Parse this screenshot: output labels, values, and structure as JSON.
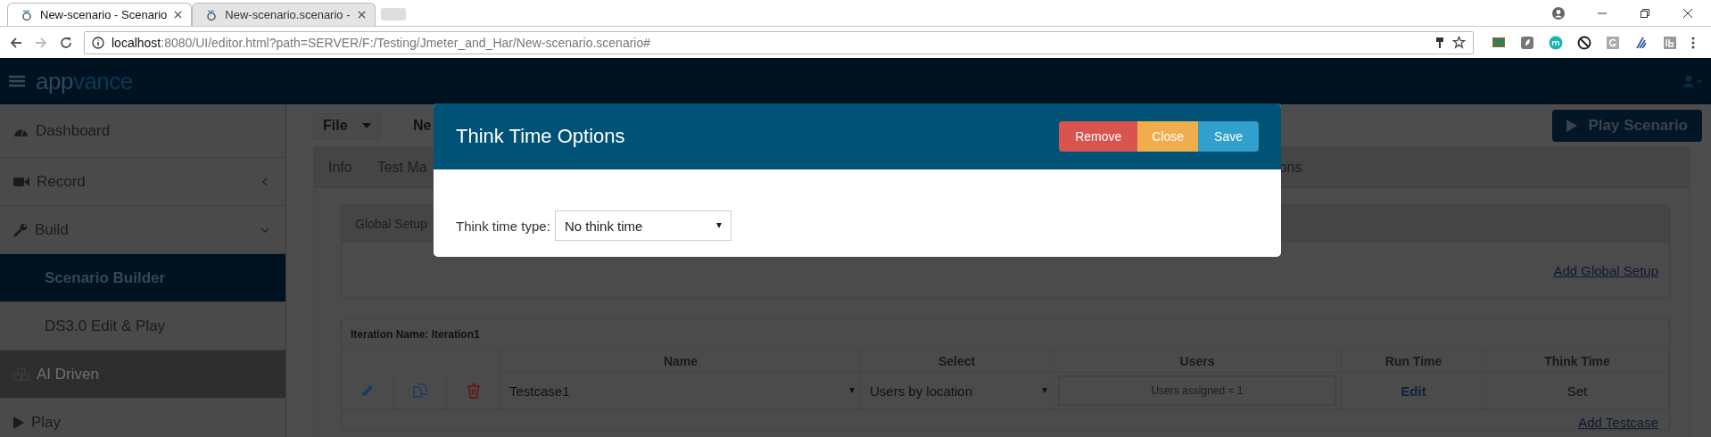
{
  "browser": {
    "tabs": [
      {
        "title": "New-scenario - Scenario",
        "selected": true
      },
      {
        "title": "New-scenario.scenario -",
        "selected": false
      }
    ],
    "address": {
      "host": "localhost",
      "path": ":8080/UI/editor.html?path=SERVER/F:/Testing/Jmeter_and_Har/New-scenario.scenario#"
    }
  },
  "app": {
    "logo": [
      "app",
      "vance"
    ],
    "sidebar": {
      "items": [
        {
          "label": "Dashboard",
          "kind": "link",
          "selected": false,
          "disabled": false
        },
        {
          "label": "Record",
          "kind": "group",
          "expanded": false,
          "selected": false,
          "disabled": false
        },
        {
          "label": "Build",
          "kind": "group",
          "expanded": true,
          "selected": false,
          "disabled": false
        },
        {
          "label": "Scenario Builder",
          "kind": "sub",
          "selected": true,
          "disabled": false
        },
        {
          "label": "DS3.0 Edit & Play",
          "kind": "sub",
          "selected": false,
          "disabled": false
        },
        {
          "label": "AI Driven",
          "kind": "link",
          "selected": false,
          "disabled": true
        },
        {
          "label": "Play",
          "kind": "link",
          "selected": false,
          "disabled": false
        }
      ]
    },
    "toolbar": {
      "file_menu": "File",
      "title": "Ne",
      "play_button": "Play Scenario"
    },
    "tabs": [
      "Info",
      "Test Ma",
      "ons"
    ],
    "global_setup": {
      "title": "Global Setup",
      "link": "Add Global Setup"
    },
    "iteration": {
      "title": "Iteration Name: Iteration1",
      "columns": [
        "Name",
        "Select",
        "Users",
        "Run Time",
        "Think Time"
      ],
      "rows": [
        {
          "name": "Testcase1",
          "select": "Users by location",
          "users": "Users assigned = 1",
          "run_time": "Edit",
          "think_time": "Set"
        }
      ],
      "link": "Add Testcase"
    }
  },
  "modal": {
    "title": "Think Time Options",
    "buttons": [
      {
        "label": "Remove",
        "kind": "danger"
      },
      {
        "label": "Close",
        "kind": "warning"
      },
      {
        "label": "Save",
        "kind": "primary"
      }
    ],
    "field": {
      "label": "Think time type:",
      "value": "No think time"
    }
  }
}
